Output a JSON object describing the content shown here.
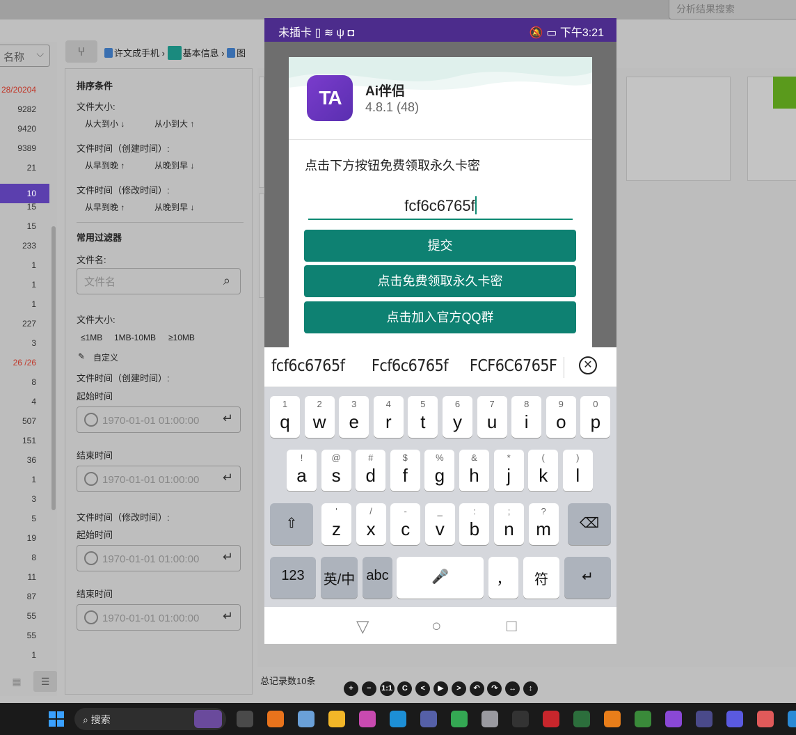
{
  "top": {
    "search_placeholder": "分析结果搜索"
  },
  "left": {
    "select_label": "名称",
    "counts": [
      "28/20204",
      "9282",
      "9420",
      "9389",
      "21",
      "10",
      "15",
      "15",
      "233",
      "1",
      "1",
      "1",
      "227",
      "3",
      "26 /26",
      "8",
      "4",
      "507",
      "151",
      "36",
      "1",
      "3",
      "5",
      "19",
      "8",
      "11",
      "87",
      "55",
      "55",
      "1"
    ],
    "active_count": "10"
  },
  "breadcrumb": [
    "许文成手机",
    "基本信息",
    "图"
  ],
  "filter": {
    "sort_title": "排序条件",
    "size_label": "文件大小:",
    "size_desc": "从大到小 ↓",
    "size_asc": "从小到大 ↑",
    "ctime_label": "文件时间（创建时间）:",
    "ctime_early": "从早到晚 ↑",
    "ctime_late": "从晚到早 ↓",
    "mtime_label": "文件时间（修改时间）:",
    "mtime_early": "从早到晚 ↑",
    "mtime_late": "从晚到早 ↓",
    "common_title": "常用过滤器",
    "filename_label": "文件名:",
    "filename_placeholder": "文件名",
    "size2_label": "文件大小:",
    "size_opt1": "≤1MB",
    "size_opt2": "1MB-10MB",
    "size_opt3": "≥10MB",
    "custom": "自定义",
    "ctime2_label": "文件时间（创建时间）:",
    "start_label": "起始时间",
    "end_label": "结束时间",
    "mtime2_label": "文件时间（修改时间）:",
    "start_label2": "起始时间",
    "end_label2": "结束时间",
    "date_value": "1970-01-01 01:00:00"
  },
  "total": "总记录数10条",
  "player_buttons": [
    "+",
    "−",
    "1:1",
    "C",
    "<",
    "▶",
    ">",
    "↶",
    "↷",
    "↔",
    "↕"
  ],
  "phone": {
    "status_left": "未插卡 ▯ ≋ ψ ◘",
    "status_right": "🔕 ▭ 下午3:21",
    "app_icon_text": "TA",
    "app_name": "Ai伴侣",
    "app_version": "4.8.1 (48)",
    "prompt": "点击下方按钮免费领取永久卡密",
    "input_value": "fcf6c6765f",
    "btn_submit": "提交",
    "btn_get": "点击免费领取永久卡密",
    "btn_qq": "点击加入官方QQ群",
    "suggestions": [
      "fcf6c6765f",
      "Fcf6c6765f",
      "FCF6C6765F"
    ]
  },
  "keyboard": {
    "row1": [
      {
        "k": "q",
        "s": "1"
      },
      {
        "k": "w",
        "s": "2"
      },
      {
        "k": "e",
        "s": "3"
      },
      {
        "k": "r",
        "s": "4"
      },
      {
        "k": "t",
        "s": "5"
      },
      {
        "k": "y",
        "s": "6"
      },
      {
        "k": "u",
        "s": "7"
      },
      {
        "k": "i",
        "s": "8"
      },
      {
        "k": "o",
        "s": "9"
      },
      {
        "k": "p",
        "s": "0"
      }
    ],
    "row2": [
      {
        "k": "a",
        "s": "!"
      },
      {
        "k": "s",
        "s": "@"
      },
      {
        "k": "d",
        "s": "#"
      },
      {
        "k": "f",
        "s": "$"
      },
      {
        "k": "g",
        "s": "%"
      },
      {
        "k": "h",
        "s": "&"
      },
      {
        "k": "j",
        "s": "*"
      },
      {
        "k": "k",
        "s": "("
      },
      {
        "k": "l",
        "s": ")"
      }
    ],
    "row3": [
      {
        "k": "z",
        "s": "'"
      },
      {
        "k": "x",
        "s": "/"
      },
      {
        "k": "c",
        "s": "-"
      },
      {
        "k": "v",
        "s": "_"
      },
      {
        "k": "b",
        "s": ":"
      },
      {
        "k": "n",
        "s": ";"
      },
      {
        "k": "m",
        "s": "?"
      }
    ],
    "num_key": "123",
    "lang_key": "英/中",
    "abc_key": "abc",
    "punct_key": "，",
    "sym_key": "符"
  },
  "taskbar": {
    "search_label": "搜索"
  }
}
